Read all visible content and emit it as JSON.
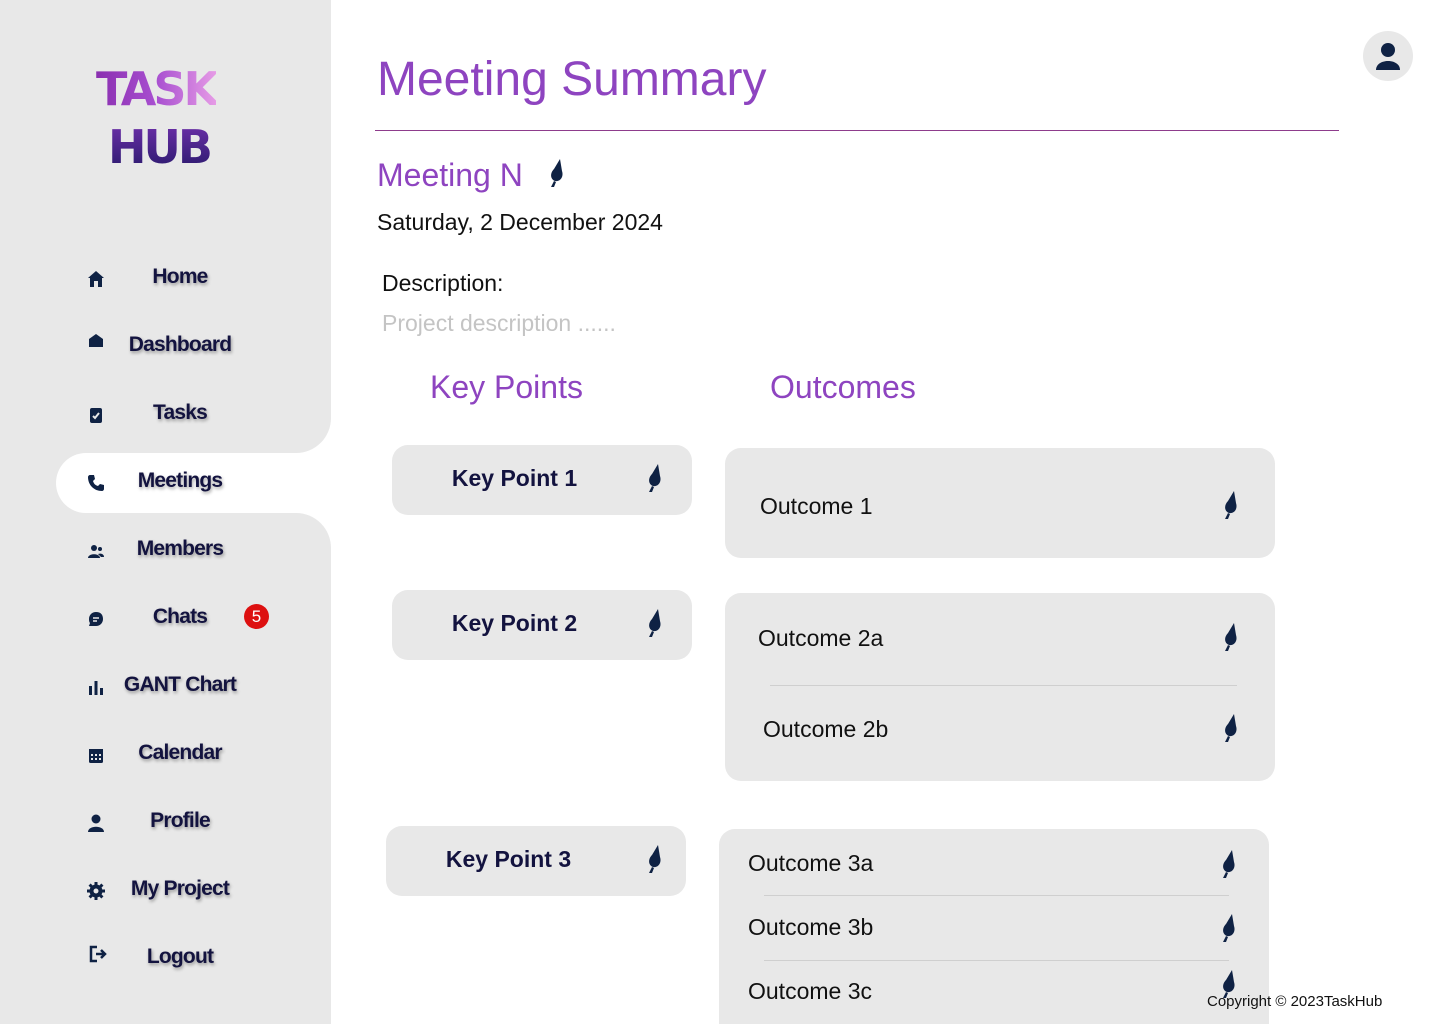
{
  "brand": {
    "line1": "TASK",
    "line2": "HUB"
  },
  "sidebar": {
    "items": [
      {
        "label": "Home",
        "icon": "home-icon"
      },
      {
        "label": "Dashboard",
        "icon": "dashboard-icon"
      },
      {
        "label": "Tasks",
        "icon": "tasks-icon"
      },
      {
        "label": "Meetings",
        "icon": "phone-icon",
        "active": true
      },
      {
        "label": "Members",
        "icon": "members-icon"
      },
      {
        "label": "Chats",
        "icon": "chat-icon",
        "badge": "5"
      },
      {
        "label": "GANT Chart",
        "icon": "bar-chart-icon"
      },
      {
        "label": "Calendar",
        "icon": "calendar-icon"
      },
      {
        "label": "Profile",
        "icon": "user-icon"
      },
      {
        "label": "My Project",
        "icon": "gear-icon"
      },
      {
        "label": "Logout",
        "icon": "logout-icon"
      }
    ]
  },
  "header": {
    "title": "Meeting Summary",
    "avatar_icon": "user-icon"
  },
  "meeting": {
    "name": "Meeting N",
    "date": "Saturday, 2 December 2024",
    "description_label": "Description:",
    "description_placeholder": "Project description ......"
  },
  "columns": {
    "key_points": "Key Points",
    "outcomes": "Outcomes"
  },
  "key_points": [
    "Key Point 1",
    "Key Point 2",
    "Key Point 3"
  ],
  "outcomes": [
    [
      "Outcome 1"
    ],
    [
      "Outcome 2a",
      "Outcome 2b"
    ],
    [
      "Outcome 3a",
      "Outcome 3b",
      "Outcome 3c"
    ]
  ],
  "footer": {
    "copyright": "Copyright © 2023TaskHub"
  },
  "colors": {
    "accent": "#8e44c0",
    "sidebar_bg": "#e8e8e8",
    "badge": "#dd1010",
    "icon": "#0f2244"
  }
}
